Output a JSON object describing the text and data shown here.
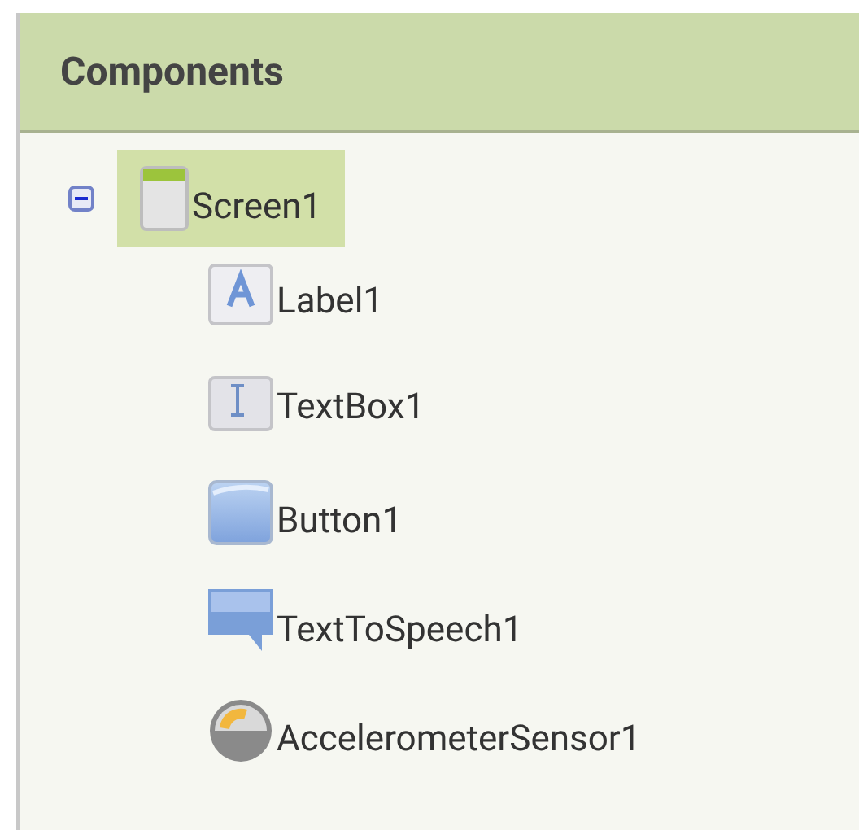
{
  "panel": {
    "title": "Components"
  },
  "tree": [
    {
      "label": "Screen1",
      "kind": "screen",
      "selected": true,
      "expanded": true,
      "children": [
        {
          "label": "Label1",
          "kind": "label",
          "selected": false
        },
        {
          "label": "TextBox1",
          "kind": "textbox",
          "selected": false
        },
        {
          "label": "Button1",
          "kind": "button",
          "selected": false
        },
        {
          "label": "TextToSpeech1",
          "kind": "speech",
          "selected": false
        },
        {
          "label": "AccelerometerSensor1",
          "kind": "sensor",
          "selected": false
        }
      ]
    }
  ]
}
